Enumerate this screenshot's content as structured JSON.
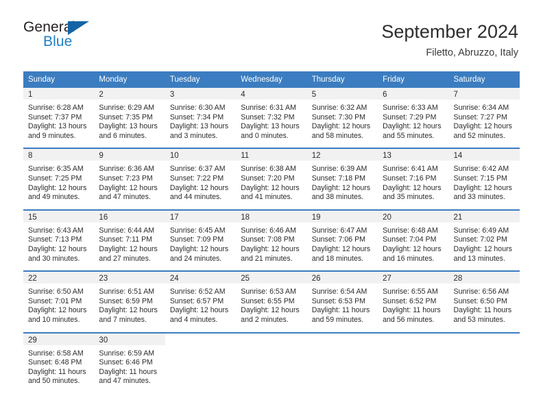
{
  "logo": {
    "word_primary": "General",
    "word_secondary": "Blue",
    "triangle_icon": "triangle-icon",
    "primary_color": "#231f20",
    "secondary_color": "#1f7fc4",
    "triangle_color": "#1464a5"
  },
  "header": {
    "title": "September 2024",
    "subtitle": "Filetto, Abruzzo, Italy"
  },
  "theme": {
    "header_bg": "#3b7dc0",
    "header_text": "#ffffff",
    "daynum_band_bg": "#f1f1f1",
    "cell_bg": "#ffffff",
    "row_divider": "#3b7dc0"
  },
  "weekdays": [
    "Sunday",
    "Monday",
    "Tuesday",
    "Wednesday",
    "Thursday",
    "Friday",
    "Saturday"
  ],
  "weeks": [
    [
      {
        "day": "1",
        "sunrise": "Sunrise: 6:28 AM",
        "sunset": "Sunset: 7:37 PM",
        "daylight1": "Daylight: 13 hours",
        "daylight2": "and 9 minutes."
      },
      {
        "day": "2",
        "sunrise": "Sunrise: 6:29 AM",
        "sunset": "Sunset: 7:35 PM",
        "daylight1": "Daylight: 13 hours",
        "daylight2": "and 6 minutes."
      },
      {
        "day": "3",
        "sunrise": "Sunrise: 6:30 AM",
        "sunset": "Sunset: 7:34 PM",
        "daylight1": "Daylight: 13 hours",
        "daylight2": "and 3 minutes."
      },
      {
        "day": "4",
        "sunrise": "Sunrise: 6:31 AM",
        "sunset": "Sunset: 7:32 PM",
        "daylight1": "Daylight: 13 hours",
        "daylight2": "and 0 minutes."
      },
      {
        "day": "5",
        "sunrise": "Sunrise: 6:32 AM",
        "sunset": "Sunset: 7:30 PM",
        "daylight1": "Daylight: 12 hours",
        "daylight2": "and 58 minutes."
      },
      {
        "day": "6",
        "sunrise": "Sunrise: 6:33 AM",
        "sunset": "Sunset: 7:29 PM",
        "daylight1": "Daylight: 12 hours",
        "daylight2": "and 55 minutes."
      },
      {
        "day": "7",
        "sunrise": "Sunrise: 6:34 AM",
        "sunset": "Sunset: 7:27 PM",
        "daylight1": "Daylight: 12 hours",
        "daylight2": "and 52 minutes."
      }
    ],
    [
      {
        "day": "8",
        "sunrise": "Sunrise: 6:35 AM",
        "sunset": "Sunset: 7:25 PM",
        "daylight1": "Daylight: 12 hours",
        "daylight2": "and 49 minutes."
      },
      {
        "day": "9",
        "sunrise": "Sunrise: 6:36 AM",
        "sunset": "Sunset: 7:23 PM",
        "daylight1": "Daylight: 12 hours",
        "daylight2": "and 47 minutes."
      },
      {
        "day": "10",
        "sunrise": "Sunrise: 6:37 AM",
        "sunset": "Sunset: 7:22 PM",
        "daylight1": "Daylight: 12 hours",
        "daylight2": "and 44 minutes."
      },
      {
        "day": "11",
        "sunrise": "Sunrise: 6:38 AM",
        "sunset": "Sunset: 7:20 PM",
        "daylight1": "Daylight: 12 hours",
        "daylight2": "and 41 minutes."
      },
      {
        "day": "12",
        "sunrise": "Sunrise: 6:39 AM",
        "sunset": "Sunset: 7:18 PM",
        "daylight1": "Daylight: 12 hours",
        "daylight2": "and 38 minutes."
      },
      {
        "day": "13",
        "sunrise": "Sunrise: 6:41 AM",
        "sunset": "Sunset: 7:16 PM",
        "daylight1": "Daylight: 12 hours",
        "daylight2": "and 35 minutes."
      },
      {
        "day": "14",
        "sunrise": "Sunrise: 6:42 AM",
        "sunset": "Sunset: 7:15 PM",
        "daylight1": "Daylight: 12 hours",
        "daylight2": "and 33 minutes."
      }
    ],
    [
      {
        "day": "15",
        "sunrise": "Sunrise: 6:43 AM",
        "sunset": "Sunset: 7:13 PM",
        "daylight1": "Daylight: 12 hours",
        "daylight2": "and 30 minutes."
      },
      {
        "day": "16",
        "sunrise": "Sunrise: 6:44 AM",
        "sunset": "Sunset: 7:11 PM",
        "daylight1": "Daylight: 12 hours",
        "daylight2": "and 27 minutes."
      },
      {
        "day": "17",
        "sunrise": "Sunrise: 6:45 AM",
        "sunset": "Sunset: 7:09 PM",
        "daylight1": "Daylight: 12 hours",
        "daylight2": "and 24 minutes."
      },
      {
        "day": "18",
        "sunrise": "Sunrise: 6:46 AM",
        "sunset": "Sunset: 7:08 PM",
        "daylight1": "Daylight: 12 hours",
        "daylight2": "and 21 minutes."
      },
      {
        "day": "19",
        "sunrise": "Sunrise: 6:47 AM",
        "sunset": "Sunset: 7:06 PM",
        "daylight1": "Daylight: 12 hours",
        "daylight2": "and 18 minutes."
      },
      {
        "day": "20",
        "sunrise": "Sunrise: 6:48 AM",
        "sunset": "Sunset: 7:04 PM",
        "daylight1": "Daylight: 12 hours",
        "daylight2": "and 16 minutes."
      },
      {
        "day": "21",
        "sunrise": "Sunrise: 6:49 AM",
        "sunset": "Sunset: 7:02 PM",
        "daylight1": "Daylight: 12 hours",
        "daylight2": "and 13 minutes."
      }
    ],
    [
      {
        "day": "22",
        "sunrise": "Sunrise: 6:50 AM",
        "sunset": "Sunset: 7:01 PM",
        "daylight1": "Daylight: 12 hours",
        "daylight2": "and 10 minutes."
      },
      {
        "day": "23",
        "sunrise": "Sunrise: 6:51 AM",
        "sunset": "Sunset: 6:59 PM",
        "daylight1": "Daylight: 12 hours",
        "daylight2": "and 7 minutes."
      },
      {
        "day": "24",
        "sunrise": "Sunrise: 6:52 AM",
        "sunset": "Sunset: 6:57 PM",
        "daylight1": "Daylight: 12 hours",
        "daylight2": "and 4 minutes."
      },
      {
        "day": "25",
        "sunrise": "Sunrise: 6:53 AM",
        "sunset": "Sunset: 6:55 PM",
        "daylight1": "Daylight: 12 hours",
        "daylight2": "and 2 minutes."
      },
      {
        "day": "26",
        "sunrise": "Sunrise: 6:54 AM",
        "sunset": "Sunset: 6:53 PM",
        "daylight1": "Daylight: 11 hours",
        "daylight2": "and 59 minutes."
      },
      {
        "day": "27",
        "sunrise": "Sunrise: 6:55 AM",
        "sunset": "Sunset: 6:52 PM",
        "daylight1": "Daylight: 11 hours",
        "daylight2": "and 56 minutes."
      },
      {
        "day": "28",
        "sunrise": "Sunrise: 6:56 AM",
        "sunset": "Sunset: 6:50 PM",
        "daylight1": "Daylight: 11 hours",
        "daylight2": "and 53 minutes."
      }
    ],
    [
      {
        "day": "29",
        "sunrise": "Sunrise: 6:58 AM",
        "sunset": "Sunset: 6:48 PM",
        "daylight1": "Daylight: 11 hours",
        "daylight2": "and 50 minutes."
      },
      {
        "day": "30",
        "sunrise": "Sunrise: 6:59 AM",
        "sunset": "Sunset: 6:46 PM",
        "daylight1": "Daylight: 11 hours",
        "daylight2": "and 47 minutes."
      },
      {
        "day": "",
        "sunrise": "",
        "sunset": "",
        "daylight1": "",
        "daylight2": "",
        "empty": true
      },
      {
        "day": "",
        "sunrise": "",
        "sunset": "",
        "daylight1": "",
        "daylight2": "",
        "empty": true
      },
      {
        "day": "",
        "sunrise": "",
        "sunset": "",
        "daylight1": "",
        "daylight2": "",
        "empty": true
      },
      {
        "day": "",
        "sunrise": "",
        "sunset": "",
        "daylight1": "",
        "daylight2": "",
        "empty": true
      },
      {
        "day": "",
        "sunrise": "",
        "sunset": "",
        "daylight1": "",
        "daylight2": "",
        "empty": true
      }
    ]
  ]
}
